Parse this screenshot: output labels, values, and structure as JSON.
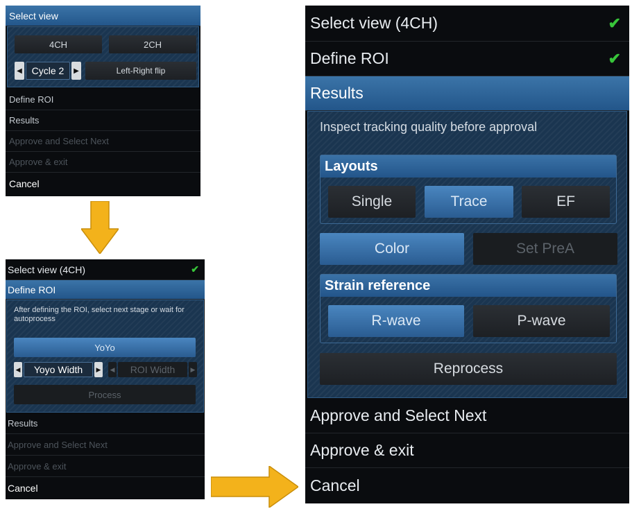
{
  "colors": {
    "accent": "#2f69a3",
    "check": "#38c53a",
    "arrow": "#f3b21b"
  },
  "panel1": {
    "header": "Select view",
    "buttons": [
      "4CH",
      "2CH"
    ],
    "cycle_label": "Cycle 2",
    "flip_label": "Left-Right flip",
    "menu": [
      "Define ROI",
      "Results",
      "Approve and Select Next",
      "Approve & exit",
      "Cancel"
    ]
  },
  "panel2": {
    "select_view": "Select view (4CH)",
    "header": "Define ROI",
    "instruction": "After defining the ROI, select next stage or wait for autoprocess",
    "yoyo": "YoYo",
    "yoyo_width": "Yoyo Width",
    "roi_width": "ROI Width",
    "process": "Process",
    "menu": [
      "Results",
      "Approve and Select Next",
      "Approve & exit",
      "Cancel"
    ]
  },
  "panel3": {
    "select_view": "Select view (4CH)",
    "define_roi": "Define ROI",
    "header": "Results",
    "instruction": "Inspect tracking quality before approval",
    "layouts_title": "Layouts",
    "layouts": [
      "Single",
      "Trace",
      "EF"
    ],
    "color": "Color",
    "set_prea": "Set PreA",
    "strain_title": "Strain reference",
    "strain": [
      "R-wave",
      "P-wave"
    ],
    "reprocess": "Reprocess",
    "menu": [
      "Approve and Select Next",
      "Approve & exit",
      "Cancel"
    ]
  }
}
